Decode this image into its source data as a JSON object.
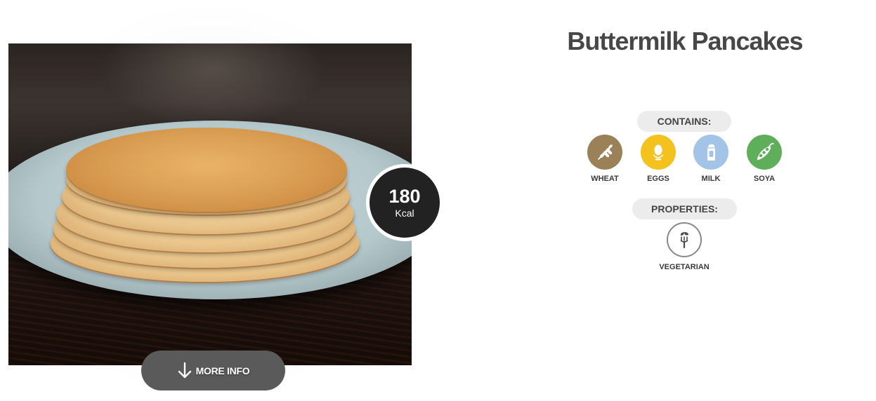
{
  "recipe": {
    "title": "Buttermilk Pancakes",
    "calories": {
      "value": "180",
      "unit": "Kcal"
    },
    "more_info_label": "MORE INFO"
  },
  "contains": {
    "heading": "CONTAINS:",
    "items": [
      {
        "label": "WHEAT",
        "icon": "wheat-icon",
        "color": "#9b8158"
      },
      {
        "label": "EGGS",
        "icon": "egg-icon",
        "color": "#f4c21f"
      },
      {
        "label": "MILK",
        "icon": "milk-carton-icon",
        "color": "#a3c4e6"
      },
      {
        "label": "SOYA",
        "icon": "soy-pod-icon",
        "color": "#5fae5a"
      }
    ]
  },
  "properties": {
    "heading": "PROPERTIES:",
    "items": [
      {
        "label": "VEGETARIAN",
        "icon": "vegetarian-fork-icon",
        "color": "#888888"
      }
    ]
  },
  "colors": {
    "title_text": "#474747",
    "kcal_badge": "#222222",
    "more_info_button": "#5a5a5a",
    "pill_background": "#ececec"
  }
}
